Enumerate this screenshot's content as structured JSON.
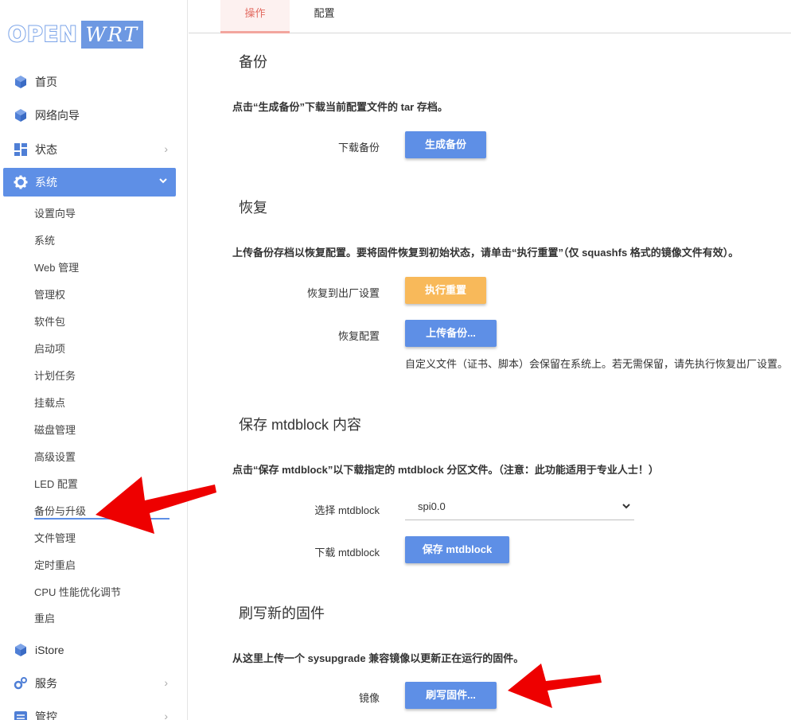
{
  "logo": {
    "open": "OPEN",
    "wrt": "WRT"
  },
  "sidebar": {
    "items": [
      {
        "label": "首页",
        "icon": "cube-icon"
      },
      {
        "label": "网络向导",
        "icon": "cube-icon"
      },
      {
        "label": "状态",
        "icon": "dashboard-icon"
      },
      {
        "label": "系统",
        "icon": "gear-icon"
      },
      {
        "label": "iStore",
        "icon": "cube-icon"
      },
      {
        "label": "服务",
        "icon": "gears-icon"
      },
      {
        "label": "管控",
        "icon": "sliders-icon"
      }
    ],
    "submenu": [
      "设置向导",
      "系统",
      "Web 管理",
      "管理权",
      "软件包",
      "启动项",
      "计划任务",
      "挂载点",
      "磁盘管理",
      "高级设置",
      "LED 配置",
      "备份与升级",
      "文件管理",
      "定时重启",
      "CPU 性能优化调节",
      "重启"
    ]
  },
  "tabs": {
    "operations": "操作",
    "config": "配置"
  },
  "backup": {
    "title": "备份",
    "desc": "点击“生成备份”下载当前配置文件的 tar 存档。",
    "download_label": "下载备份",
    "generate_button": "生成备份"
  },
  "restore": {
    "title": "恢复",
    "desc": "上传备份存档以恢复配置。要将固件恢复到初始状态，请单击“执行重置”（仅 squashfs 格式的镜像文件有效）。",
    "factory_label": "恢复到出厂设置",
    "reset_button": "执行重置",
    "restore_label": "恢复配置",
    "upload_button": "上传备份...",
    "help": "自定义文件（证书、脚本）会保留在系统上。若无需保留，请先执行恢复出厂设置。"
  },
  "mtd": {
    "title": "保存 mtdblock 内容",
    "desc": "点击“保存 mtdblock”以下载指定的 mtdblock 分区文件。（注意：此功能适用于专业人士！）",
    "select_label": "选择 mtdblock",
    "select_value": "spi0.0",
    "download_label": "下载 mtdblock",
    "save_button": "保存 mtdblock"
  },
  "flash": {
    "title": "刷写新的固件",
    "desc": "从这里上传一个 sysupgrade 兼容镜像以更新正在运行的固件。",
    "image_label": "镜像",
    "flash_button": "刷写固件..."
  },
  "colors": {
    "accent": "#5e8fe6",
    "warning": "#f8b95a",
    "tab_active": "#e26a60",
    "arrow": "#ee0000"
  }
}
